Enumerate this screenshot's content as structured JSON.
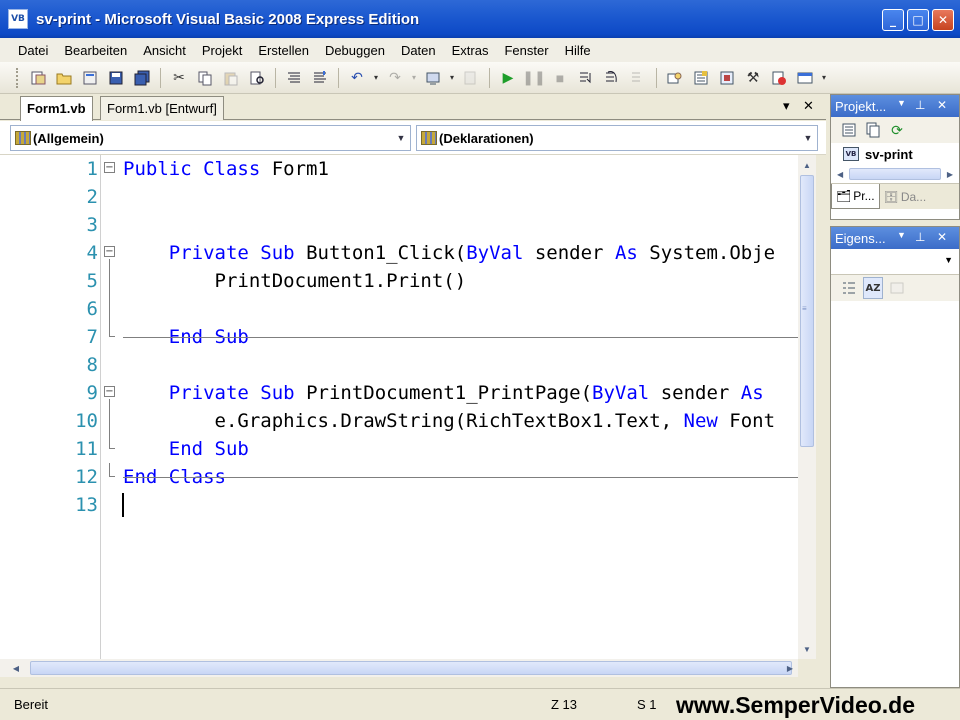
{
  "window": {
    "title": "sv-print - Microsoft Visual Basic 2008 Express Edition",
    "app_icon": "VB",
    "controls": [
      "minimize-icon",
      "maximize-icon",
      "close-icon"
    ]
  },
  "menu": [
    "Datei",
    "Bearbeiten",
    "Ansicht",
    "Projekt",
    "Erstellen",
    "Debuggen",
    "Daten",
    "Extras",
    "Fenster",
    "Hilfe"
  ],
  "toolbar": {
    "icons": [
      "new-project-icon",
      "open-file-icon",
      "add-item-icon",
      "save-icon",
      "save-all-icon",
      "cut-icon",
      "copy-icon",
      "paste-icon",
      "find-icon",
      "comment-icon",
      "uncomment-icon",
      "undo-icon",
      "redo-icon",
      "navigate-icon",
      "start-debug-icon",
      "pause-icon",
      "stop-icon",
      "step-into-icon",
      "step-over-icon",
      "step-out-icon",
      "solution-explorer-icon",
      "properties-icon",
      "object-browser-icon",
      "toolbox-icon",
      "error-list-icon",
      "output-icon"
    ]
  },
  "editor": {
    "tabs": [
      {
        "label": "Form1.vb",
        "active": true
      },
      {
        "label": "Form1.vb [Entwurf]",
        "active": false
      }
    ],
    "tab_controls": {
      "dropdown": "▾",
      "close": "✕"
    },
    "class_dropdown": "(Allgemein)",
    "method_dropdown": "(Deklarationen)",
    "lines": [
      {
        "n": "1",
        "text": "Public Class Form1"
      },
      {
        "n": "2",
        "text": ""
      },
      {
        "n": "3",
        "text": ""
      },
      {
        "n": "4",
        "text": "    Private Sub Button1_Click(ByVal sender As System.Obje"
      },
      {
        "n": "5",
        "text": "        PrintDocument1.Print()"
      },
      {
        "n": "6",
        "text": ""
      },
      {
        "n": "7",
        "text": "    End Sub"
      },
      {
        "n": "8",
        "text": ""
      },
      {
        "n": "9",
        "text": "    Private Sub PrintDocument1_PrintPage(ByVal sender As "
      },
      {
        "n": "10",
        "text": "        e.Graphics.DrawString(RichTextBox1.Text, New Font"
      },
      {
        "n": "11",
        "text": "    End Sub"
      },
      {
        "n": "12",
        "text": "End Class"
      },
      {
        "n": "13",
        "text": ""
      }
    ],
    "keyword_color": "#0000ff",
    "line_number_color": "#2b91af"
  },
  "solution_panel": {
    "title": "Projekt...",
    "pin": "📌",
    "close": "✕",
    "project": "sv-print",
    "tabs": [
      {
        "label": "Pr...",
        "active": true
      },
      {
        "label": "Da...",
        "active": false
      }
    ]
  },
  "properties_panel": {
    "title": "Eigens...",
    "pin": "📌",
    "close": "✕"
  },
  "status": {
    "text": "Bereit",
    "line": "Z 13",
    "col": "S 1"
  },
  "watermark": "www.SemperVideo.de"
}
